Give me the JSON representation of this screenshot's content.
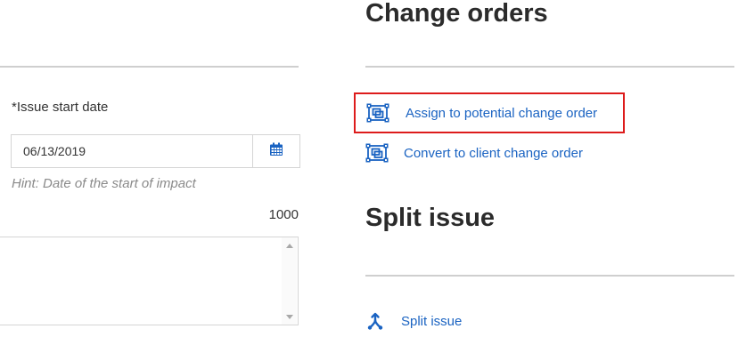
{
  "issue_form": {
    "start_date_label": "*Issue start date",
    "start_date_value": "06/13/2019",
    "start_date_hint": "Hint: Date of the start of impact",
    "char_counter": "1000"
  },
  "change_orders": {
    "heading": "Change orders",
    "assign_label": "Assign to potential change order",
    "convert_label": "Convert to client change order",
    "icon": "change-order-icon"
  },
  "split_section": {
    "heading": "Split issue",
    "split_label": "Split issue",
    "icon": "split-icon"
  },
  "colors": {
    "link": "#1a63c2",
    "highlight": "#dd1c1c",
    "rule": "#cfcfcf",
    "hint": "#8a8a8a"
  }
}
